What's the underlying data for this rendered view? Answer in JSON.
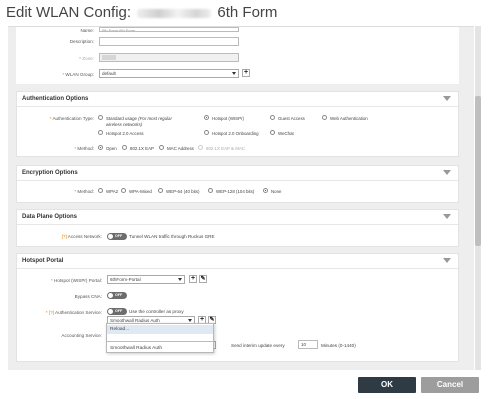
{
  "dialog": {
    "title_prefix": "Edit WLAN Config:",
    "title_suffix": "6th Form"
  },
  "general": {
    "name_label": "Name:",
    "name_value": "6th Form 6th Form",
    "description_label": "Description:",
    "description_value": "",
    "zone_label": "Zone:",
    "zone_value": "",
    "wlan_group_label": "WLAN Group:",
    "wlan_group_value": "default"
  },
  "auth_options": {
    "title": "Authentication Options",
    "type_label": "Authentication Type:",
    "types": {
      "standard": "Standard usage",
      "standard_note": "(For most regular",
      "standard_note2": "wireless networks)",
      "hotspot_wispr": "Hotspot (WISPr)",
      "guest_access": "Guest Access",
      "web_auth": "Web Authentication",
      "hotspot20_access": "Hotspot 2.0 Access",
      "hotspot20_onboarding": "Hotspot 2.0 Onboarding",
      "wechat": "WeChat"
    },
    "method_label": "Method:",
    "methods": {
      "open": "Open",
      "eap": "802.1X EAP",
      "mac": "MAC Address",
      "eap_mac": "802.1X EAP & MAC"
    }
  },
  "encryption": {
    "title": "Encryption Options",
    "method_label": "Method:",
    "methods": {
      "wpa2": "WPA2",
      "wpa_mixed": "WPA-Mixed",
      "wep64": "WEP-64 (40 bits)",
      "wep128": "WEP-128 (104 bits)",
      "none": "None"
    }
  },
  "data_plane": {
    "title": "Data Plane Options",
    "help": "[?]",
    "access_network_label": "Access Network:",
    "toggle_text": "OFF",
    "tunnel_text": "Tunnel WLAN traffic through Ruckus GRE"
  },
  "hotspot": {
    "title": "Hotspot Portal",
    "portal_label": "Hotspot (WISPr) Portal:",
    "portal_value": "6thForm-Portal",
    "bypass_label": "Bypass CNA:",
    "bypass_toggle": "OFF",
    "help": "[?]",
    "auth_service_label": "Authentication Service:",
    "auth_toggle": "OFF",
    "use_controller": "Use the controller as proxy",
    "auth_service_value": "Smoothwall Radius Auth",
    "accounting_label": "Accounting Service:",
    "interim_text": "Send interim update every",
    "interim_value": "10",
    "interim_unit": "Minutes (0-1440)"
  },
  "dropdown": {
    "items": [
      "Reload...",
      "",
      "Smoothwall Radius Auth"
    ]
  },
  "footer": {
    "ok_label": "OK",
    "cancel_label": "Cancel"
  },
  "colors": {
    "primary_button": "#2e3a44",
    "cancel_button": "#9d9d9d",
    "required": "#e07b00",
    "section_bg": "#eeeeee"
  }
}
